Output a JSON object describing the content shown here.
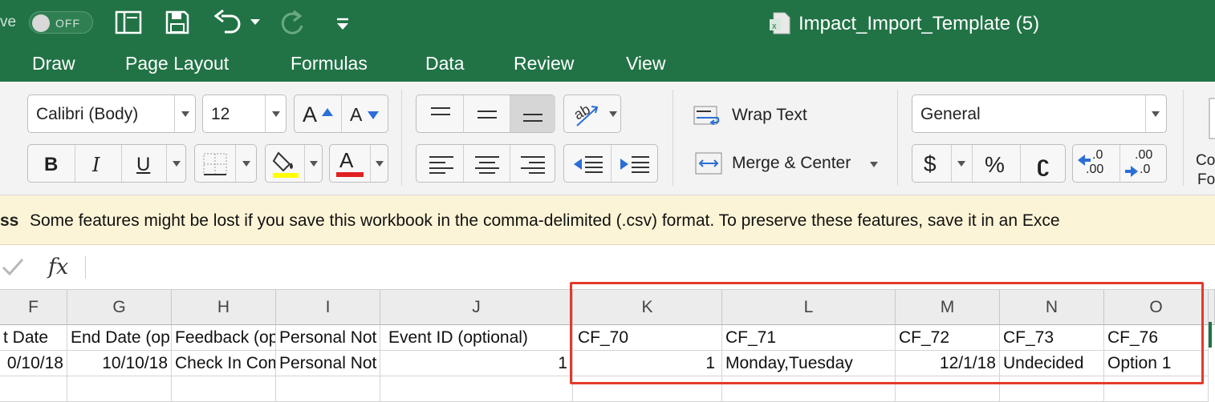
{
  "titlebar": {
    "autosave_label": "ve",
    "autosave_toggle": "OFF",
    "document_title": "Impact_Import_Template (5)",
    "icons": [
      "sidebar-icon",
      "save-icon",
      "undo-icon",
      "redo-icon",
      "customize-icon"
    ]
  },
  "tabs": [
    "Draw",
    "Page Layout",
    "Formulas",
    "Data",
    "Review",
    "View"
  ],
  "ribbon": {
    "font_name": "Calibri (Body)",
    "font_size": "12",
    "bold": "B",
    "italic": "I",
    "underline": "U",
    "increase_font": "A",
    "decrease_font": "A",
    "font_color_letter": "A",
    "wrap_text": "Wrap Text",
    "merge_center": "Merge & Center",
    "number_format": "General",
    "currency": "$",
    "percent": "%",
    "comma": "ʗ",
    "inc_decimal_top": ".0",
    "inc_decimal_bottom": ".00",
    "dec_decimal_top": ".00",
    "dec_decimal_bottom": ".0",
    "cond_format_partial_1": "Co",
    "cond_format_partial_2": "Fo",
    "highlight_color": "#ffff00",
    "font_color": "#e02020"
  },
  "message_bar": {
    "bold_text": "ss",
    "message": "Some features might be lost if you save this workbook in the comma-delimited (.csv) format. To preserve these features, save it in an Exce"
  },
  "formula_bar": {
    "fx": "fx",
    "value": ""
  },
  "grid": {
    "columns": [
      "F",
      "G",
      "H",
      "I",
      "J",
      "K",
      "L",
      "M",
      "N",
      "O"
    ],
    "header_row": [
      "t Date",
      "End Date (op",
      "Feedback (op",
      "Personal Not",
      "Event ID (optional)",
      "CF_70",
      "CF_71",
      "CF_72",
      "CF_73",
      "CF_76"
    ],
    "data_row": [
      "0/10/18",
      "10/10/18",
      "Check In Com",
      "Personal Not",
      "1",
      "1",
      "Monday,Tuesday",
      "12/1/18",
      "Undecided",
      "Option 1"
    ]
  },
  "colors": {
    "excel_green": "#217346",
    "highlight_box": "#e33a2c",
    "message_bar_bg": "#fcf4d6"
  }
}
